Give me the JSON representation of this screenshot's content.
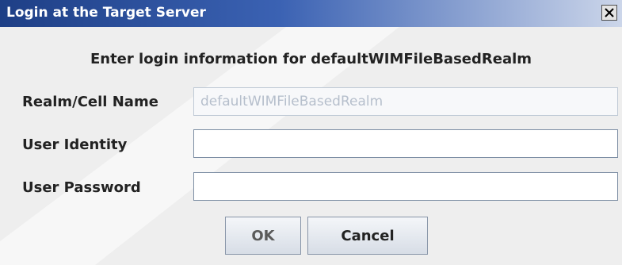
{
  "window": {
    "title": "Login at the Target Server",
    "close_icon": "close-icon"
  },
  "header": {
    "text": "Enter login information for defaultWIMFileBasedRealm"
  },
  "form": {
    "realm_label": "Realm/Cell Name",
    "realm_value": "defaultWIMFileBasedRealm",
    "user_label": "User Identity",
    "user_value": "",
    "password_label": "User Password",
    "password_value": ""
  },
  "buttons": {
    "ok_label": "OK",
    "cancel_label": "Cancel"
  }
}
